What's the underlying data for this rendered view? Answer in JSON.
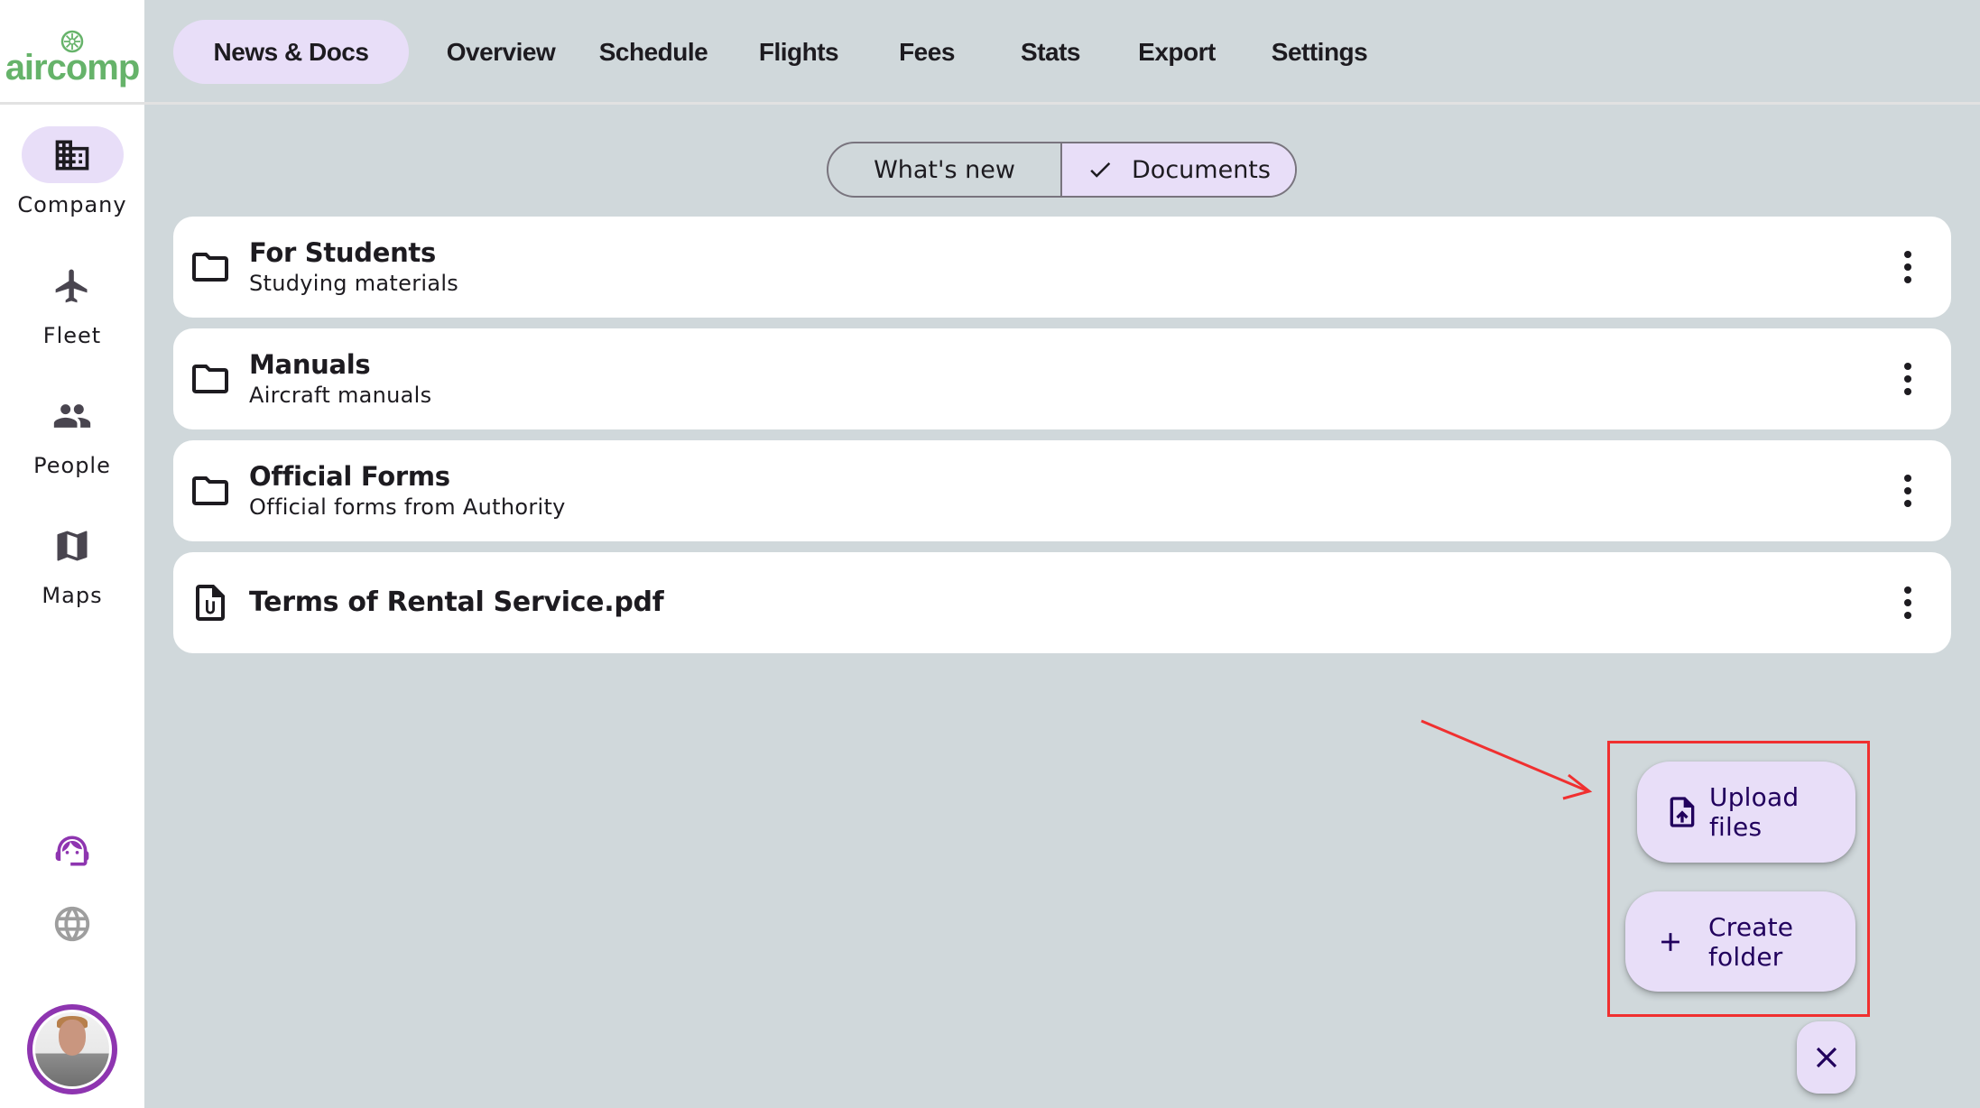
{
  "app": {
    "logo_text": "aircomp",
    "brand_color": "#66b36a",
    "accent_color": "#e8def8",
    "avatar_ring_color": "#8e35b0"
  },
  "sidebar": {
    "items": [
      {
        "label": "Company",
        "icon": "building-icon",
        "active": true
      },
      {
        "label": "Fleet",
        "icon": "airplane-icon",
        "active": false
      },
      {
        "label": "People",
        "icon": "people-icon",
        "active": false
      },
      {
        "label": "Maps",
        "icon": "map-icon",
        "active": false
      }
    ],
    "bottom_icons": [
      "support-agent-icon",
      "globe-icon"
    ],
    "avatar_alt": "User avatar"
  },
  "topnav": {
    "tabs": [
      {
        "label": "News & Docs",
        "active": true
      },
      {
        "label": "Overview",
        "active": false
      },
      {
        "label": "Schedule",
        "active": false
      },
      {
        "label": "Flights",
        "active": false
      },
      {
        "label": "Fees",
        "active": false
      },
      {
        "label": "Stats",
        "active": false
      },
      {
        "label": "Export",
        "active": false
      },
      {
        "label": "Settings",
        "active": false
      }
    ]
  },
  "segmented": {
    "options": [
      {
        "label": "What's new",
        "selected": false
      },
      {
        "label": "Documents",
        "selected": true
      }
    ]
  },
  "documents": [
    {
      "type": "folder",
      "title": "For Students",
      "subtitle": "Studying materials"
    },
    {
      "type": "folder",
      "title": "Manuals",
      "subtitle": "Aircraft manuals"
    },
    {
      "type": "folder",
      "title": "Official Forms",
      "subtitle": "Official forms from Authority"
    },
    {
      "type": "file",
      "title": "Terms of Rental Service.pdf",
      "subtitle": ""
    }
  ],
  "fab_menu": {
    "upload_label": "Upload files",
    "create_label": "Create folder",
    "close_icon": "close-icon"
  },
  "annotation": {
    "color": "#f03030",
    "highlights": "fab-menu"
  }
}
